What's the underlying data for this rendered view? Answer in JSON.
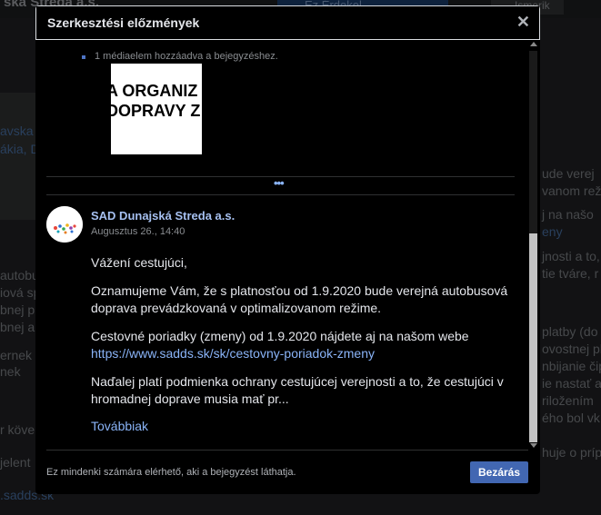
{
  "background": {
    "page_title": "ská Streda a.s.",
    "primary_button": "Ez Érdekel",
    "secondary_button": "Ismerik",
    "left_fragments": [
      "avska",
      "ákia, D",
      "autobu",
      "iová sp",
      "bnej p",
      "bnej aut",
      "ernek t",
      "nek",
      "r köve",
      "jelent",
      ".sadds.sk"
    ],
    "right_fragments": [
      "ude verej",
      "vanom rež",
      "j na našo",
      "eny",
      "jnosti a to,",
      "tie tváre, r",
      "platby (do",
      "ovostnej pla",
      "nbijanie čip",
      "ie nastať až",
      "riložením",
      "ého bol vk",
      "huje o príp"
    ]
  },
  "modal": {
    "title": "Szerkesztési előzmények",
    "close_icon": "close-icon",
    "media_note": "1 médiaelem hozzáadva a bejegyzéshez.",
    "thumbnail_lines": [
      "A ORGANIZ",
      "DOPRAVY Z"
    ],
    "more_dots": "•••",
    "post": {
      "author": "SAD Dunajská Streda a.s.",
      "timestamp": "Augusztus 26., 14:40",
      "greeting": "Vážení cestujúci,",
      "para1": "Oznamujeme Vám, že s platnosťou od 1.9.2020 bude verejná autobusová doprava prevádzkovaná v optimalizovanom režime.",
      "para2_text": "Cestovné poriadky (zmeny) od 1.9.2020 nájdete aj na našom webe",
      "para2_link": "https://www.sadds.sk/sk/cestovny-poriadok-zmeny",
      "para3": "Naďalej platí podmienka ochrany cestujúcej verejnosti a to, že cestujúci v hromadnej doprave musia mať pr...",
      "see_more": "Továbbiak"
    },
    "footer_text": "Ez mindenki számára elérhető, aki a bejegyzést láthatja.",
    "close_button": "Bezárás"
  },
  "colors": {
    "accent": "#4267b2",
    "link": "#8ab4f8",
    "modal_bg": "#000000",
    "page_bg": "#18191a"
  }
}
